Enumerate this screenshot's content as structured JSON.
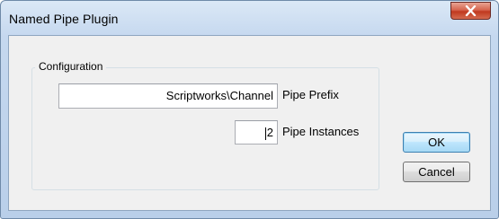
{
  "window": {
    "title": "Named Pipe Plugin",
    "close_icon": "close-icon"
  },
  "configuration": {
    "group_label": "Configuration",
    "pipe_prefix": {
      "value": "Scriptworks\\Channel",
      "label": "Pipe Prefix"
    },
    "pipe_instances": {
      "value": "2",
      "label": "Pipe Instances"
    }
  },
  "buttons": {
    "ok_label": "OK",
    "cancel_label": "Cancel"
  },
  "colors": {
    "title_bar": "#c5d8ef",
    "close_button": "#c0391f",
    "client_background": "#f0f0f0",
    "default_button_border": "#3c7fb1"
  }
}
